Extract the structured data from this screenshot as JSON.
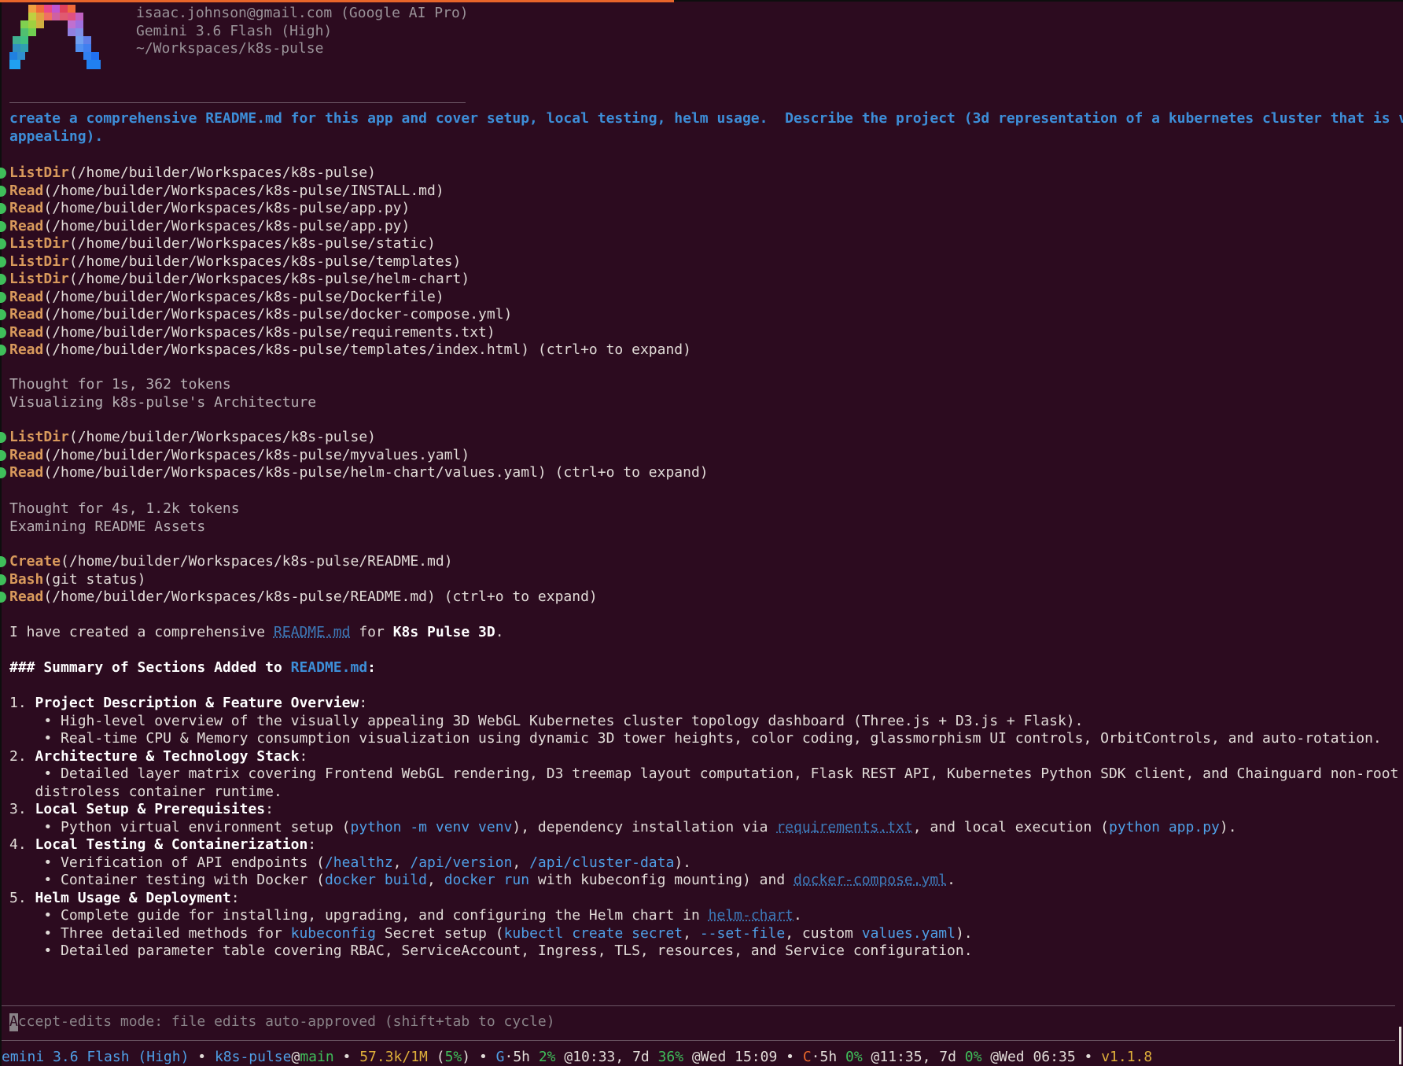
{
  "header": {
    "account": "isaac.johnson@gmail.com (Google AI Pro)",
    "model": "Gemini 3.6 Flash (High)",
    "path": "~/Workspaces/k8s-pulse"
  },
  "prompt": {
    "line1": "create a comprehensive README.md for this app and cover setup, local testing, helm usage.  Describe the project (3d representation of a kubernetes cluster that is visually",
    "line2": "appealing)."
  },
  "tool_group_1": [
    {
      "name": "ListDir",
      "args": "(/home/builder/Workspaces/k8s-pulse)"
    },
    {
      "name": "Read",
      "args": "(/home/builder/Workspaces/k8s-pulse/INSTALL.md)"
    },
    {
      "name": "Read",
      "args": "(/home/builder/Workspaces/k8s-pulse/app.py)"
    },
    {
      "name": "Read",
      "args": "(/home/builder/Workspaces/k8s-pulse/app.py)"
    },
    {
      "name": "ListDir",
      "args": "(/home/builder/Workspaces/k8s-pulse/static)"
    },
    {
      "name": "ListDir",
      "args": "(/home/builder/Workspaces/k8s-pulse/templates)"
    },
    {
      "name": "ListDir",
      "args": "(/home/builder/Workspaces/k8s-pulse/helm-chart)"
    },
    {
      "name": "Read",
      "args": "(/home/builder/Workspaces/k8s-pulse/Dockerfile)"
    },
    {
      "name": "Read",
      "args": "(/home/builder/Workspaces/k8s-pulse/docker-compose.yml)"
    },
    {
      "name": "Read",
      "args": "(/home/builder/Workspaces/k8s-pulse/requirements.txt)"
    },
    {
      "name": "Read",
      "args": "(/home/builder/Workspaces/k8s-pulse/templates/index.html) (ctrl+o to expand)"
    }
  ],
  "thought_1": {
    "meta": "Thought for 1s, 362 tokens",
    "title": "Visualizing k8s-pulse's Architecture"
  },
  "tool_group_2": [
    {
      "name": "ListDir",
      "args": "(/home/builder/Workspaces/k8s-pulse)"
    },
    {
      "name": "Read",
      "args": "(/home/builder/Workspaces/k8s-pulse/myvalues.yaml)"
    },
    {
      "name": "Read",
      "args": "(/home/builder/Workspaces/k8s-pulse/helm-chart/values.yaml) (ctrl+o to expand)"
    }
  ],
  "thought_2": {
    "meta": "Thought for 4s, 1.2k tokens",
    "title": "Examining README Assets"
  },
  "tool_group_3": [
    {
      "name": "Create",
      "args": "(/home/builder/Workspaces/k8s-pulse/README.md)"
    },
    {
      "name": "Bash",
      "args": "(git status)"
    },
    {
      "name": "Read",
      "args": "(/home/builder/Workspaces/k8s-pulse/README.md) (ctrl+o to expand)"
    }
  ],
  "response": {
    "intro_a": "I have created a comprehensive ",
    "intro_link": "README.md",
    "intro_b": " for ",
    "intro_bold": "K8s Pulse 3D",
    "intro_c": ".",
    "summary_heading": "### Summary of Sections Added to ",
    "summary_link": "README.md",
    "summary_colon": ":",
    "s1_num": "1. ",
    "s1_title": "Project Description & Feature Overview",
    "s1_b1": "    • High-level overview of the visually appealing 3D WebGL Kubernetes cluster topology dashboard (Three.js + D3.js + Flask).",
    "s1_b2": "    • Real-time CPU & Memory consumption visualization using dynamic 3D tower heights, color coding, glassmorphism UI controls, OrbitControls, and auto-rotation.",
    "s2_num": "2. ",
    "s2_title": "Architecture & Technology Stack",
    "s2_b1a": "    • Detailed layer matrix covering Frontend WebGL rendering, D3 treemap layout computation, Flask REST API, Kubernetes Python SDK client, and Chainguard non-root",
    "s2_b1b": "   distroless container runtime.",
    "s3_num": "3. ",
    "s3_title": "Local Setup & Prerequisites",
    "s3_b1_pre": "    • Python virtual environment setup (",
    "s3_b1_code1": "python -m venv venv",
    "s3_b1_mid": "), dependency installation via ",
    "s3_b1_link": "requirements.txt",
    "s3_b1_mid2": ", and local execution (",
    "s3_b1_code2": "python app.py",
    "s3_b1_end": ").",
    "s4_num": "4. ",
    "s4_title": "Local Testing & Containerization",
    "s4_b1_pre": "    • Verification of API endpoints (",
    "s4_b1_c1": "/healthz",
    "s4_b1_sep1": ", ",
    "s4_b1_c2": "/api/version",
    "s4_b1_sep2": ", ",
    "s4_b1_c3": "/api/cluster-data",
    "s4_b1_end": ").",
    "s4_b2_pre": "    • Container testing with Docker (",
    "s4_b2_c1": "docker build",
    "s4_b2_sep": ", ",
    "s4_b2_c2": "docker run",
    "s4_b2_mid": " with kubeconfig mounting) and ",
    "s4_b2_link": "docker-compose.yml",
    "s4_b2_end": ".",
    "s5_num": "5. ",
    "s5_title": "Helm Usage & Deployment",
    "s5_b1_pre": "    • Complete guide for installing, upgrading, and configuring the Helm chart in ",
    "s5_b1_link": "helm-chart",
    "s5_b1_end": ".",
    "s5_b2_pre": "    • Three detailed methods for ",
    "s5_b2_c1": "kubeconfig",
    "s5_b2_mid": " Secret setup (",
    "s5_b2_c2": "kubectl create secret",
    "s5_b2_sep1": ", ",
    "s5_b2_c3": "--set-file",
    "s5_b2_sep2": ", custom ",
    "s5_b2_c4": "values.yaml",
    "s5_b2_end": ").",
    "s5_b3": "    • Detailed parameter table covering RBAC, ServiceAccount, Ingress, TLS, resources, and Service configuration."
  },
  "input": {
    "cursor_char": "A",
    "mode_text": "ccept-edits mode: file edits auto-approved (shift+tab to cycle)"
  },
  "status_bar": {
    "model": "emini 3.6 Flash (High)",
    "sep": " • ",
    "repo": "k8s-pulse",
    "at": "@",
    "branch": "main",
    "tokens": "57.3k/1M",
    "tokens_pct_open": " (",
    "tokens_pct": "5%",
    "tokens_pct_close": ")",
    "g_label": "G",
    "g_5h": "·5h ",
    "g_5h_pct": "2%",
    "g_5h_time": " @10:33, 7d ",
    "g_7d_pct": "36%",
    "g_7d_time": " @Wed 15:09",
    "c_label": "C",
    "c_5h": "·5h ",
    "c_5h_pct": "0%",
    "c_5h_time": " @11:35, 7d ",
    "c_7d_pct": "0%",
    "c_7d_time": " @Wed 06:35",
    "version": "v1.1.8",
    "colors": {
      "accent_orange": "#e8652a",
      "green": "#3fbf5a",
      "blue": "#4f9fe6",
      "yellow": "#e0b03a",
      "background": "#2c0b1f"
    }
  }
}
